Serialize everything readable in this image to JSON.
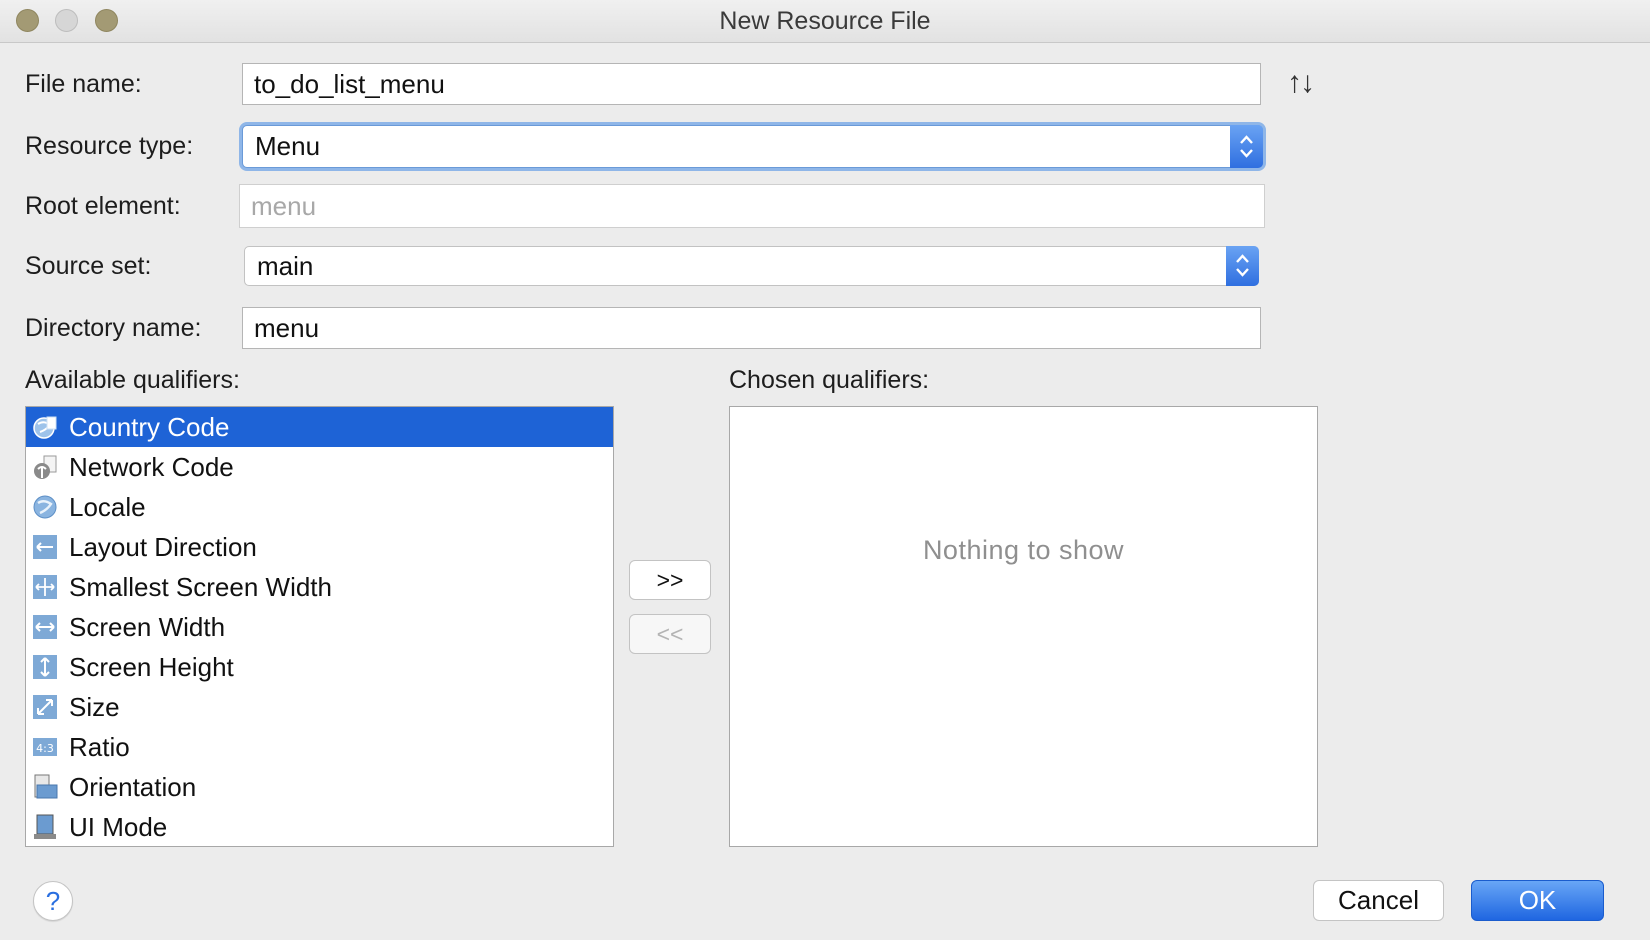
{
  "window": {
    "title": "New Resource File"
  },
  "form": {
    "file_name": {
      "label": "File name:",
      "value": "to_do_list_menu"
    },
    "resource_type": {
      "label": "Resource type:",
      "value": "Menu"
    },
    "root_element": {
      "label": "Root element:",
      "value": "menu"
    },
    "source_set": {
      "label": "Source set:",
      "value": "main"
    },
    "directory_name": {
      "label": "Directory name:",
      "value": "menu"
    },
    "sort_icon": "up-down-arrows-icon"
  },
  "qualifiers": {
    "available_label": "Available qualifiers:",
    "chosen_label": "Chosen qualifiers:",
    "available": [
      {
        "label": "Country Code",
        "icon": "globe-sim-icon",
        "selected": true
      },
      {
        "label": "Network Code",
        "icon": "network-antenna-icon"
      },
      {
        "label": "Locale",
        "icon": "globe-icon"
      },
      {
        "label": "Layout Direction",
        "icon": "layout-direction-icon"
      },
      {
        "label": "Smallest Screen Width",
        "icon": "smallest-width-icon"
      },
      {
        "label": "Screen Width",
        "icon": "screen-width-icon"
      },
      {
        "label": "Screen Height",
        "icon": "screen-height-icon"
      },
      {
        "label": "Size",
        "icon": "size-icon"
      },
      {
        "label": "Ratio",
        "icon": "ratio-icon"
      },
      {
        "label": "Orientation",
        "icon": "orientation-icon"
      },
      {
        "label": "UI Mode",
        "icon": "ui-mode-icon"
      }
    ],
    "chosen_empty_text": "Nothing to show",
    "add_button": ">>",
    "remove_button": "<<"
  },
  "footer": {
    "help": "?",
    "cancel": "Cancel",
    "ok": "OK"
  },
  "colors": {
    "selection": "#1e63d6",
    "accent": "#2f6fe0"
  }
}
